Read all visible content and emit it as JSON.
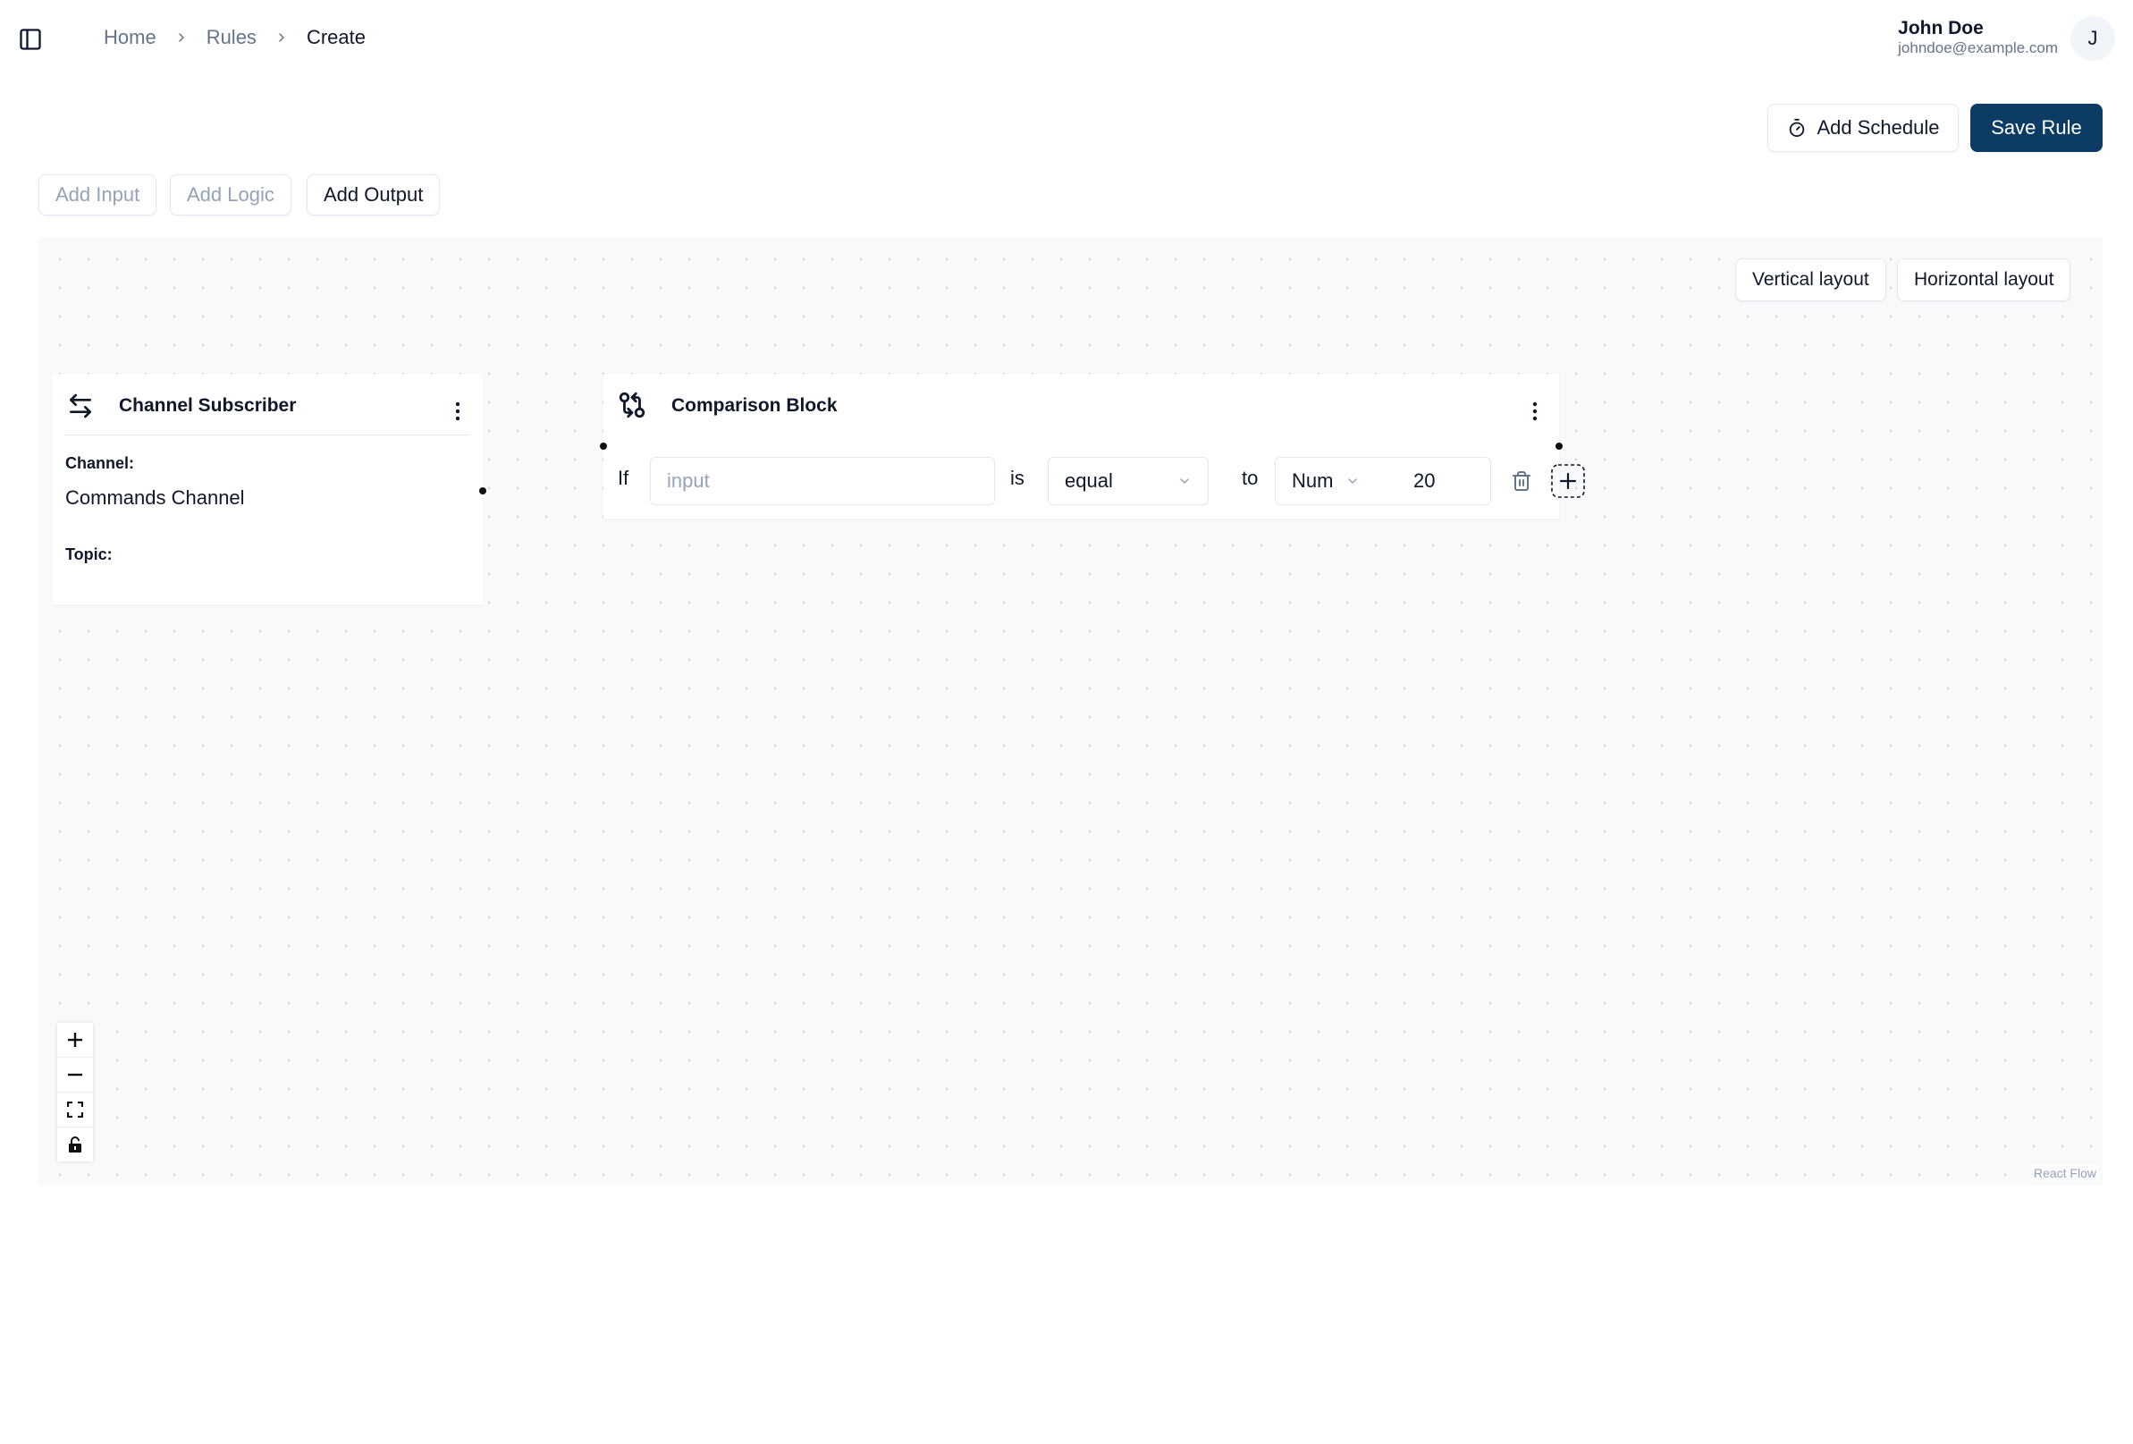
{
  "breadcrumb": {
    "items": [
      "Home",
      "Rules",
      "Create"
    ]
  },
  "user": {
    "name": "John Doe",
    "email": "johndoe@example.com",
    "avatar_initial": "J"
  },
  "actions": {
    "add_schedule": "Add Schedule",
    "save_rule": "Save Rule"
  },
  "toolbar": {
    "add_input": "Add Input",
    "add_logic": "Add Logic",
    "add_output": "Add Output"
  },
  "canvas": {
    "vertical_layout": "Vertical layout",
    "horizontal_layout": "Horizontal layout",
    "attribution": "React Flow"
  },
  "channel_node": {
    "title": "Channel Subscriber",
    "channel_label": "Channel:",
    "channel_value": "Commands Channel",
    "topic_label": "Topic:"
  },
  "comparison_node": {
    "title": "Comparison Block",
    "if_label": "If",
    "input_placeholder": "input",
    "is_label": "is",
    "operator_value": "equal",
    "to_label": "to",
    "type_value": "Num",
    "compare_value": "20"
  },
  "colors": {
    "primary": "#0c3b64",
    "canvas_bg": "#f8f9fa",
    "muted_text": "#64748b"
  }
}
